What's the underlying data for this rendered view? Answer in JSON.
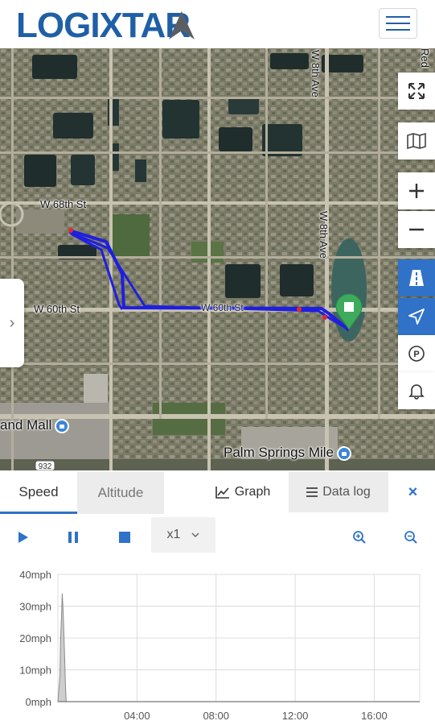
{
  "header": {
    "logo_text": "LOGIXTAR",
    "menu_icon": "hamburger-menu-icon"
  },
  "map": {
    "streets": {
      "w68th": "W 68th St",
      "w60th": "W 60th St",
      "w60th_overlay": "W 60th St",
      "w8th_top": "W 8th Ave",
      "w8th_mid": "W 8th Ave",
      "red_partial": "Red"
    },
    "pois": {
      "mall": "and Mall",
      "palm_springs": "Palm Springs Mile"
    },
    "route_badge": "932",
    "controls": [
      "fullscreen-icon",
      "map-layers-icon",
      "zoom-in-icon",
      "zoom-out-icon",
      "traffic-icon",
      "location-icon",
      "parking-icon",
      "bell-icon"
    ],
    "colors": {
      "route": "#1f1fe0",
      "marker_green": "#3daa5c",
      "control_blue": "#2f72c8"
    }
  },
  "tabs": {
    "speed": "Speed",
    "altitude": "Altitude",
    "graph": "Graph",
    "data_log": "Data log",
    "close": "×"
  },
  "playback": {
    "speed_value": "x1"
  },
  "chart_data": {
    "type": "area",
    "title": "",
    "xlabel": "",
    "ylabel": "",
    "y_ticks": [
      "0mph",
      "10mph",
      "20mph",
      "30mph",
      "40mph"
    ],
    "ylim": [
      0,
      40
    ],
    "x_ticks": [
      "04:00",
      "08:00",
      "12:00",
      "16:00"
    ],
    "xlim": [
      0.0,
      18.3
    ],
    "grid": true,
    "series": [
      {
        "x": [
          0.0,
          0.1,
          0.14,
          0.18,
          0.22,
          0.26,
          0.3,
          0.34,
          0.38,
          0.42,
          18.3
        ],
        "values": [
          0,
          8,
          20,
          26,
          34,
          29,
          22,
          14,
          6,
          0,
          0
        ]
      }
    ]
  }
}
